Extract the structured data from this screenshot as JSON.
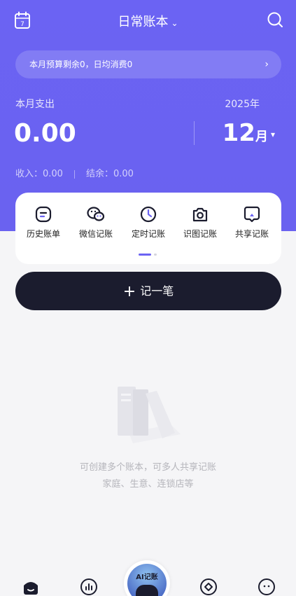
{
  "header": {
    "title": "日常账本",
    "title_chevron": "⌄",
    "left_icon": "calendar-icon",
    "left_icon_text": "7",
    "right_icon": "search-icon"
  },
  "budget": {
    "text": "本月预算剩余0，日均消费0",
    "arrow": "›"
  },
  "summary": {
    "label": "本月支出",
    "amount": "0.00",
    "year": "2025年",
    "month": "12",
    "month_suffix": "月",
    "caret": "▾",
    "income": "收入：0.00",
    "balance": "结余：0.00"
  },
  "quick_actions": [
    {
      "label": "历史账单",
      "icon": "bill-icon"
    },
    {
      "label": "微信记账",
      "icon": "wechat-icon"
    },
    {
      "label": "定时记账",
      "icon": "clock-icon"
    },
    {
      "label": "识图记账",
      "icon": "camera-icon"
    },
    {
      "label": "共享记账",
      "icon": "share-icon"
    }
  ],
  "pager": {
    "pages": 2,
    "active": 1
  },
  "record_button": {
    "plus": "+",
    "label": "记一笔"
  },
  "empty_state": {
    "line1": "可创建多个账本，可多人共享记账",
    "line2": "家庭、生意、连锁店等"
  },
  "tabbar": {
    "tabs": [
      {
        "icon": "home-icon"
      },
      {
        "icon": "stats-icon"
      },
      {
        "icon": "ai-icon",
        "label": "AI记账"
      },
      {
        "icon": "discover-icon"
      },
      {
        "icon": "profile-icon"
      }
    ]
  },
  "colors": {
    "primary": "#6b63f3",
    "dark": "#1b1c2e",
    "background": "#f5f5f7"
  }
}
